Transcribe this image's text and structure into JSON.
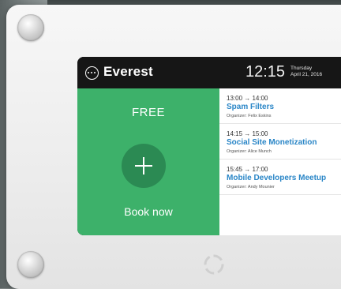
{
  "room": {
    "name": "Everest"
  },
  "clock": {
    "time": "12:15",
    "weekday": "Thursday",
    "date": "April 21, 2016"
  },
  "status": {
    "label": "FREE",
    "action_label": "Book now",
    "color": "#3db16a"
  },
  "schedule": {
    "events": [
      {
        "time": "13:00 → 14:00",
        "title": "Spam Filters",
        "organizer": "Organizer: Felix Eskins"
      },
      {
        "time": "14:15 → 15:00",
        "title": "Social Site Monetization",
        "organizer": "Organizer: Alice Munch"
      },
      {
        "time": "15:45 → 17:00",
        "title": "Mobile Developers Meetup",
        "organizer": "Organizer: Andy Mounier"
      }
    ]
  },
  "colors": {
    "accent": "#2a86c7",
    "topbar": "#161616",
    "button": "#2b8a53"
  }
}
